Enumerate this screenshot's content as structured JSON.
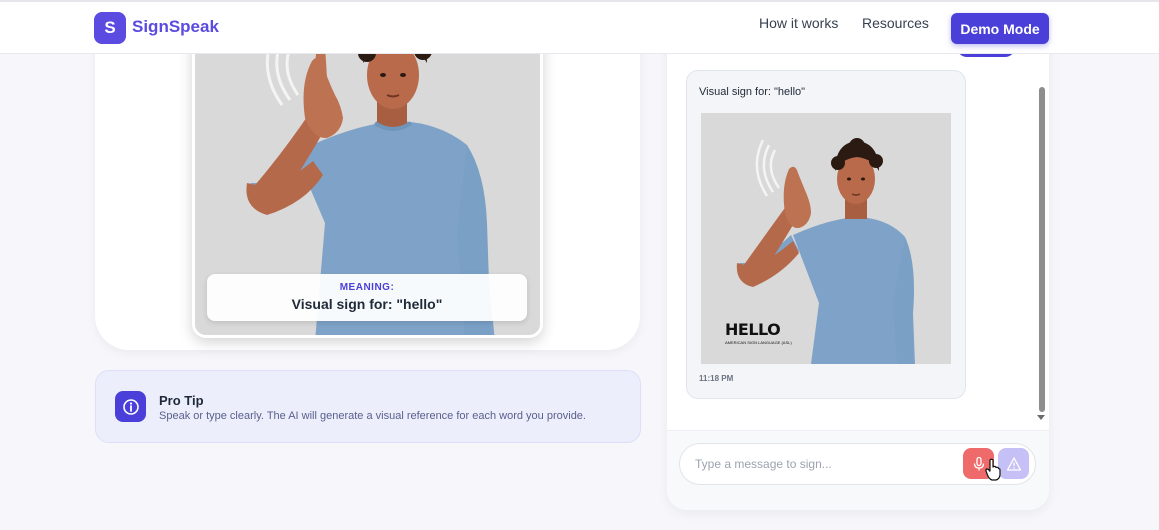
{
  "header": {
    "logo_letter": "S",
    "brand": "SignSpeak",
    "nav": [
      {
        "label": "How it works"
      },
      {
        "label": "Resources"
      }
    ],
    "demo_button": "Demo Mode"
  },
  "viewer": {
    "meaning_label": "MEANING:",
    "meaning_text": "Visual sign for: \"hello\""
  },
  "tip": {
    "title": "Pro Tip",
    "text": "Speak or type clearly. The AI will generate a visual reference for each word you provide."
  },
  "chat": {
    "message": {
      "text": "Visual sign for: \"hello\"",
      "image_caption": "HELLO",
      "image_subcaption": "AMERICAN SIGN LANGUAGE (ASL)",
      "time": "11:18 PM"
    },
    "input_placeholder": "Type a message to sign...",
    "mic_icon": "microphone-icon",
    "send_icon": "send-icon"
  },
  "colors": {
    "brand": "#5b4be0",
    "accent": "#4a3fd8",
    "mic": "#ef6a6a",
    "send_disabled": "#c5c0f5"
  }
}
